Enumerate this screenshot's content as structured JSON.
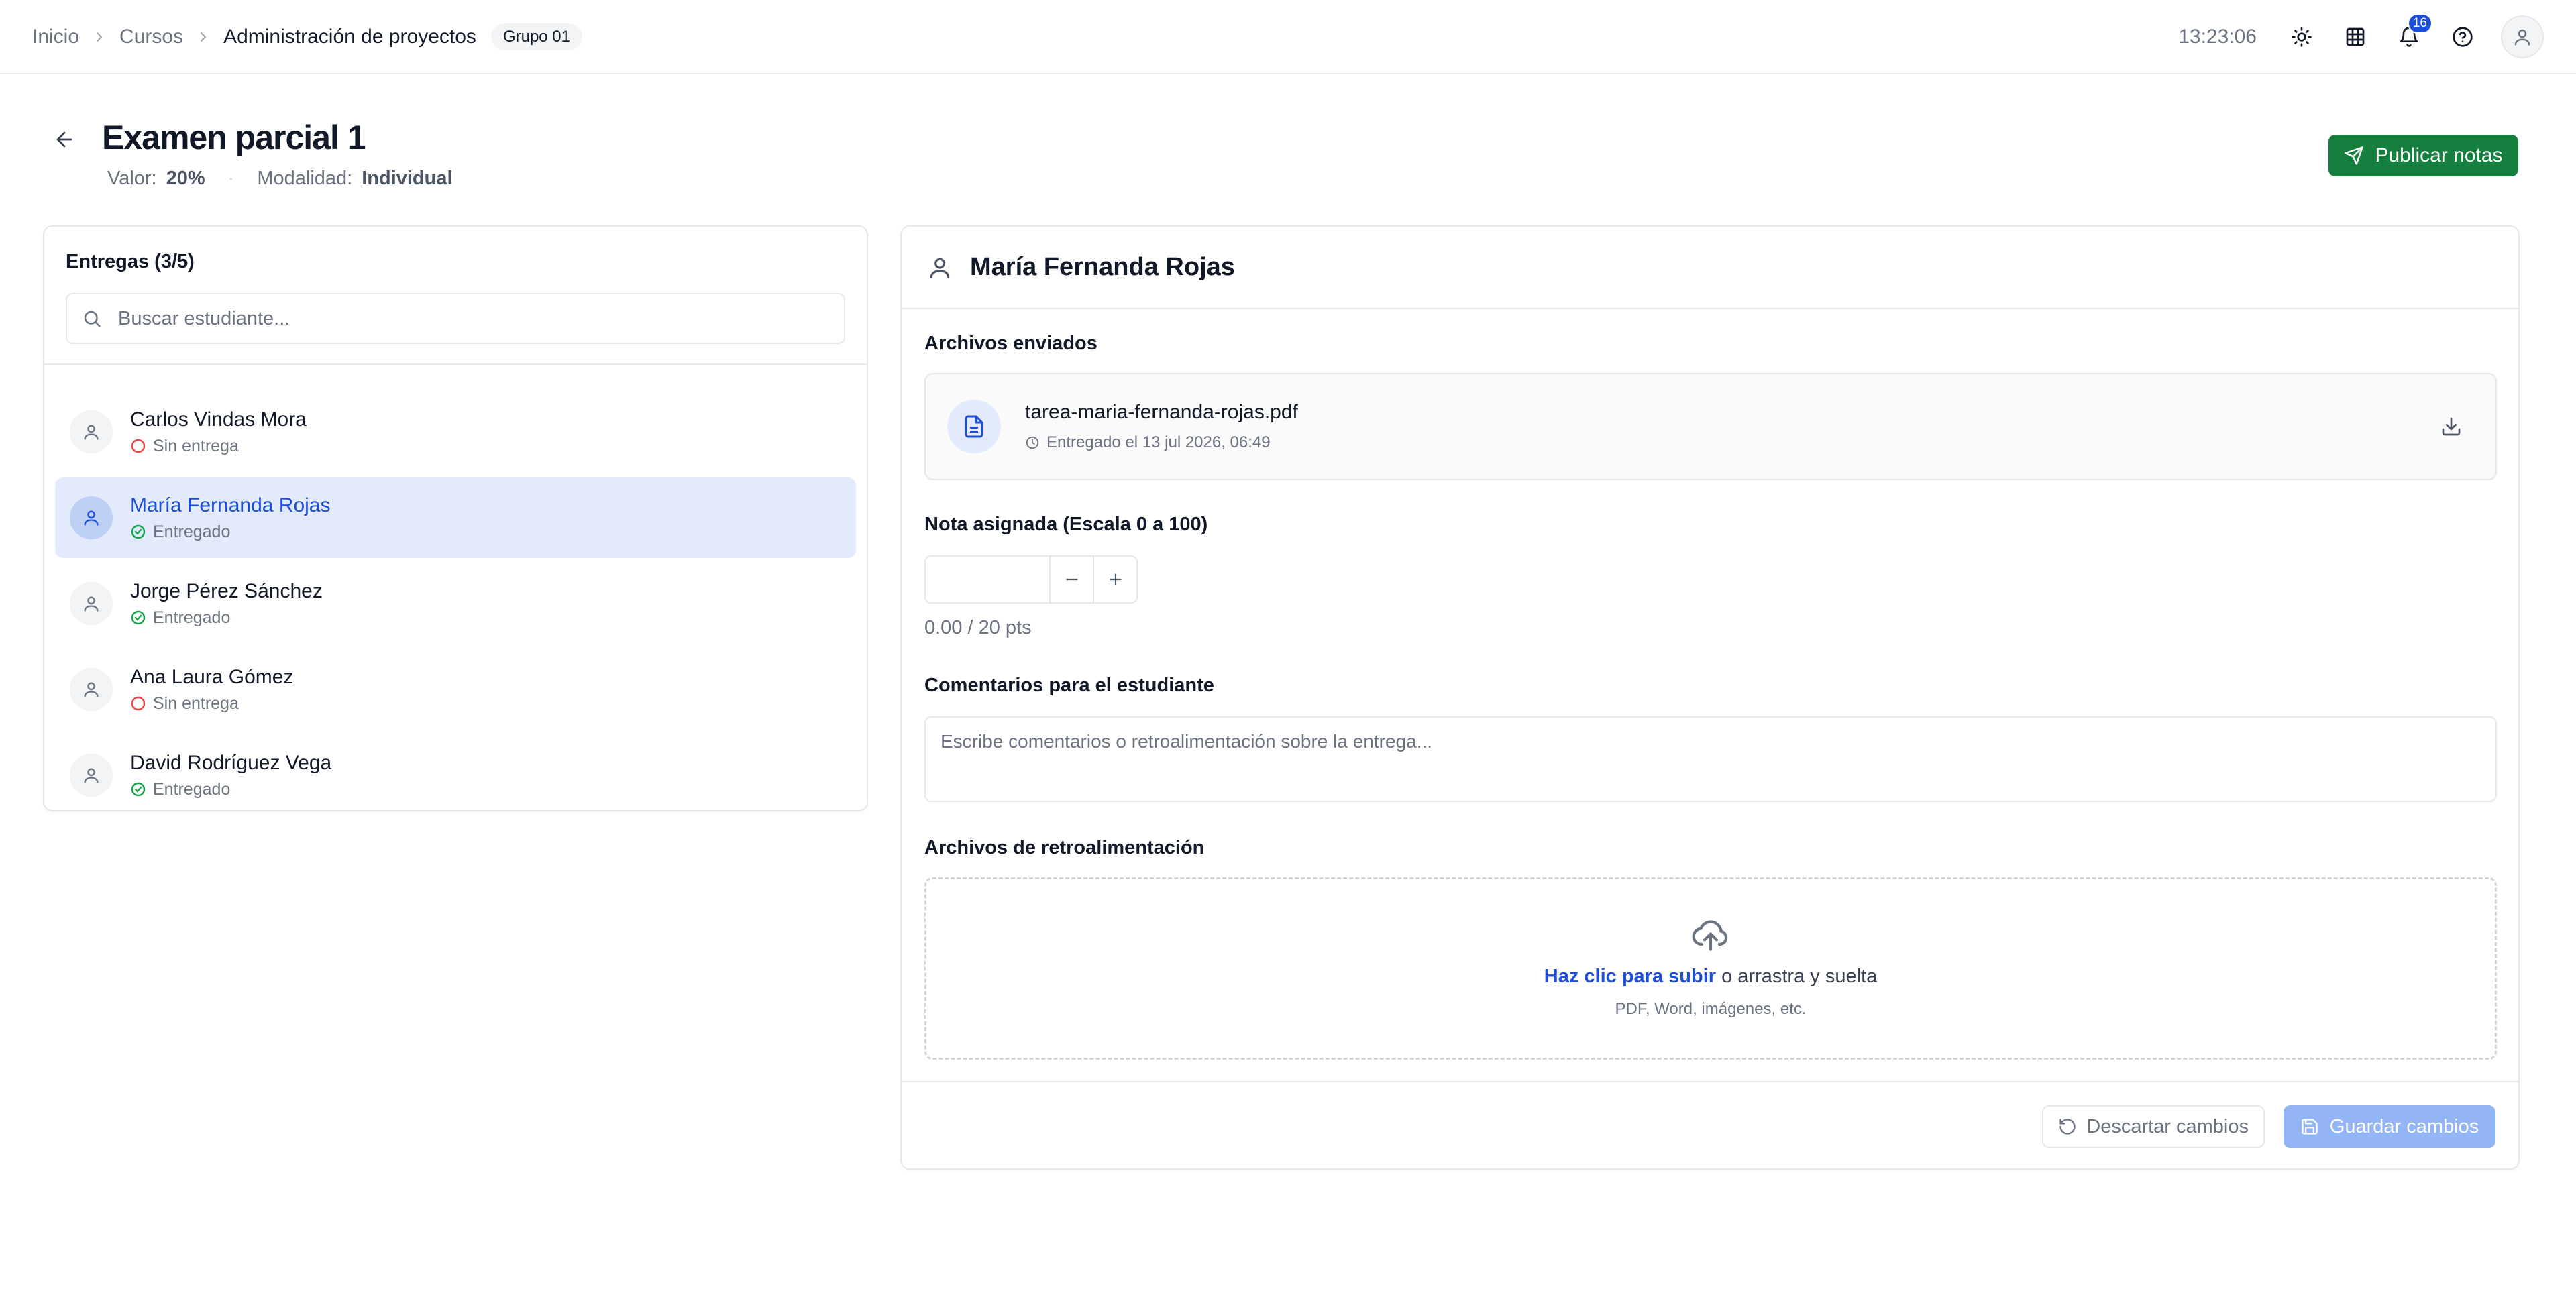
{
  "breadcrumb": {
    "items": [
      "Inicio",
      "Cursos",
      "Administración de proyectos"
    ],
    "group_badge": "Grupo 01"
  },
  "topbar": {
    "time": "13:23:06",
    "notifications_count": "16"
  },
  "page": {
    "title": "Examen parcial 1",
    "value_label": "Valor:",
    "value": "20%",
    "modality_label": "Modalidad:",
    "modality": "Individual",
    "publish_label": "Publicar notas"
  },
  "submissions": {
    "title": "Entregas (3/5)",
    "search_placeholder": "Buscar estudiante...",
    "students": [
      {
        "name": "Carlos Vindas Mora",
        "status": "Sin entrega",
        "submitted": false,
        "active": false
      },
      {
        "name": "María Fernanda Rojas",
        "status": "Entregado",
        "submitted": true,
        "active": true
      },
      {
        "name": "Jorge Pérez Sánchez",
        "status": "Entregado",
        "submitted": true,
        "active": false
      },
      {
        "name": "Ana Laura Gómez",
        "status": "Sin entrega",
        "submitted": false,
        "active": false
      },
      {
        "name": "David Rodríguez Vega",
        "status": "Entregado",
        "submitted": true,
        "active": false
      }
    ]
  },
  "detail": {
    "student_name": "María Fernanda Rojas",
    "files_label": "Archivos enviados",
    "file_name": "tarea-maria-fernanda-rojas.pdf",
    "file_date": "Entregado el 13 jul 2026, 06:49",
    "grade_label": "Nota asignada (Escala 0 a 100)",
    "grade_value": "",
    "points": "0.00 / 20 pts",
    "comments_label": "Comentarios para el estudiante",
    "comments_placeholder": "Escribe comentarios o retroalimentación sobre la entrega...",
    "feedback_label": "Archivos de retroalimentación",
    "upload_link": "Haz clic para subir",
    "upload_text": " o arrastra y suelta",
    "upload_hint": "PDF, Word, imágenes, etc.",
    "discard_label": "Descartar cambios",
    "save_label": "Guardar cambios"
  },
  "colors": {
    "primary": "#1d4ed8",
    "publish": "#15803d",
    "submitted": "#16a34a",
    "not_submitted": "#ef4444",
    "save_disabled": "#93b4f5"
  }
}
